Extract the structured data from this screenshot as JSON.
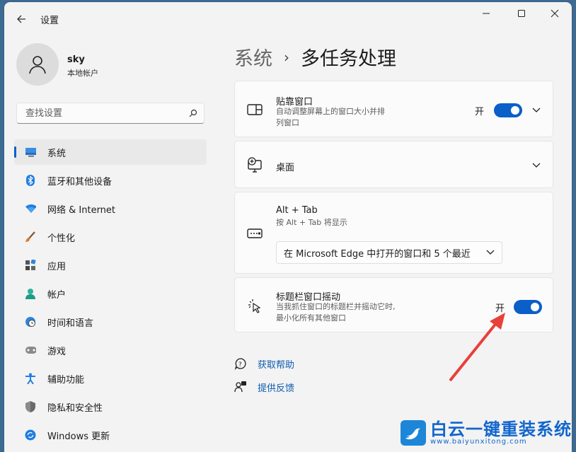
{
  "window": {
    "title": "设置"
  },
  "user": {
    "name": "sky",
    "account_type": "本地帐户"
  },
  "search": {
    "placeholder": "查找设置"
  },
  "nav": {
    "items": [
      {
        "label": "系统",
        "icon": "monitor-icon",
        "active": true
      },
      {
        "label": "蓝牙和其他设备",
        "icon": "bluetooth-icon"
      },
      {
        "label": "网络 & Internet",
        "icon": "wifi-icon"
      },
      {
        "label": "个性化",
        "icon": "brush-icon"
      },
      {
        "label": "应用",
        "icon": "apps-icon"
      },
      {
        "label": "帐户",
        "icon": "person-icon"
      },
      {
        "label": "时间和语言",
        "icon": "globe-clock-icon"
      },
      {
        "label": "游戏",
        "icon": "gamepad-icon"
      },
      {
        "label": "辅助功能",
        "icon": "accessibility-icon"
      },
      {
        "label": "隐私和安全性",
        "icon": "shield-icon"
      },
      {
        "label": "Windows 更新",
        "icon": "update-icon"
      }
    ]
  },
  "breadcrumb": {
    "parent": "系统",
    "separator": "›",
    "current": "多任务处理"
  },
  "cards": {
    "snap": {
      "title": "贴靠窗口",
      "desc_line1": "自动调整屏幕上的窗口大小并排",
      "desc_line2": "列窗口",
      "state_label": "开",
      "toggle_on": true
    },
    "desktops": {
      "title": "桌面"
    },
    "alttab": {
      "title": "Alt + Tab",
      "desc": "按 Alt + Tab 将显示",
      "selected": "在 Microsoft Edge 中打开的窗口和 5 个最近"
    },
    "shake": {
      "title": "标题栏窗口摇动",
      "desc_line1": "当我抓住窗口的标题栏并摇动它时,",
      "desc_line2": "最小化所有其他窗口",
      "state_label": "开",
      "toggle_on": true
    }
  },
  "links": {
    "help": "获取帮助",
    "feedback": "提供反馈"
  },
  "watermark": {
    "title": "白云一键重装系统",
    "url": "www.baiyunxitong.com"
  },
  "colors": {
    "accent": "#0a5fc8",
    "link": "#0b5cad",
    "annotation_arrow": "#e8403a"
  }
}
